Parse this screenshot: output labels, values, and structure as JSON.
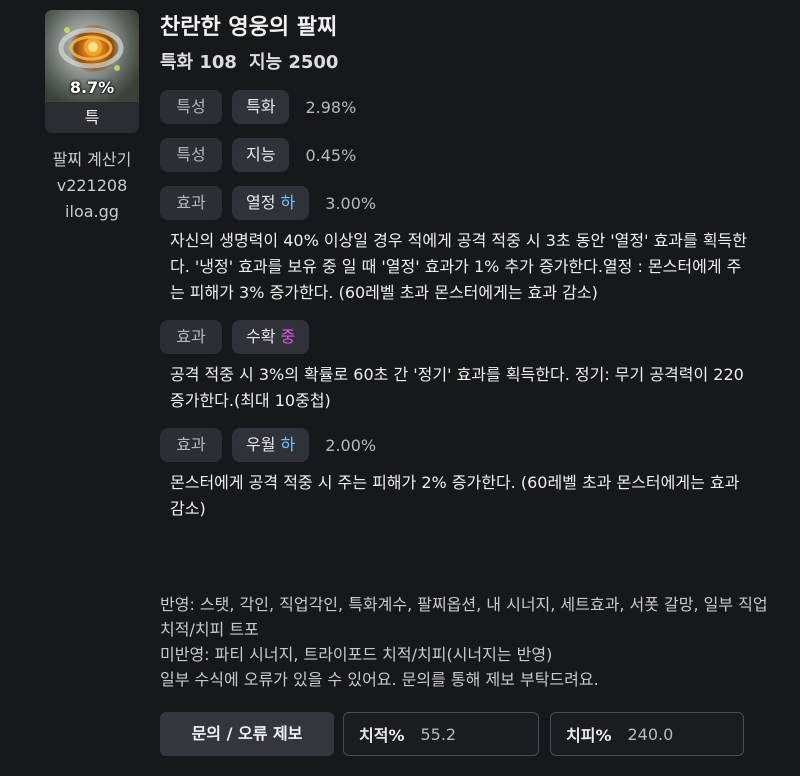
{
  "item": {
    "percent": "8.7%",
    "grade": "특",
    "title": "찬란한 영웅의 팔찌",
    "stats": [
      "특화 108",
      "지능 2500"
    ]
  },
  "calculator": {
    "name": "팔찌 계산기",
    "version": "v221208",
    "site": "iloa.gg"
  },
  "rows": [
    {
      "type": "특성",
      "name": "특화",
      "value": "2.98%"
    },
    {
      "type": "특성",
      "name": "지능",
      "value": "0.45%"
    },
    {
      "type": "효과",
      "name": "열정",
      "level": "하",
      "value": "3.00%",
      "desc": "자신의 생명력이 40% 이상일 경우 적에게 공격 적중 시 3초 동안 '열정' 효과를 획득한다. '냉정' 효과를 보유 중 일 때 '열정' 효과가 1% 추가 증가한다.열정 : 몬스터에게 주는 피해가 3% 증가한다. (60레벨 초과 몬스터에게는 효과 감소)"
    },
    {
      "type": "효과",
      "name": "수확",
      "level": "중",
      "value": "",
      "desc": "공격 적중 시 3%의 확률로 60초 간 '정기' 효과를 획득한다. 정기: 무기 공격력이 220 증가한다.(최대 10중첩)"
    },
    {
      "type": "효과",
      "name": "우월",
      "level": "하",
      "value": "2.00%",
      "desc": "몬스터에게 공격 적중 시 주는 피해가 2% 증가한다. (60레벨 초과 몬스터에게는 효과 감소)"
    }
  ],
  "notes": {
    "line1": "반영: 스탯, 각인, 직업각인, 특화계수, 팔찌옵션, 내 시너지, 세트효과, 서폿 갈망, 일부 직업 치적/치피 트포",
    "line2": "미반영: 파티 시너지, 트라이포드 치적/치피(시너지는 반영)",
    "line3": "일부 수식에 오류가 있을 수 있어요. 문의를 통해 제보 부탁드려요."
  },
  "footer": {
    "report_label": "문의 / 오류 제보",
    "crit_rate_label": "치적%",
    "crit_rate_value": "55.2",
    "crit_dmg_label": "치피%",
    "crit_dmg_value": "240.0"
  },
  "colors": {
    "level_ha": "#6fc3ff",
    "level_jung": "#e65ae8"
  },
  "icons": {
    "item": "bracelet-icon"
  }
}
